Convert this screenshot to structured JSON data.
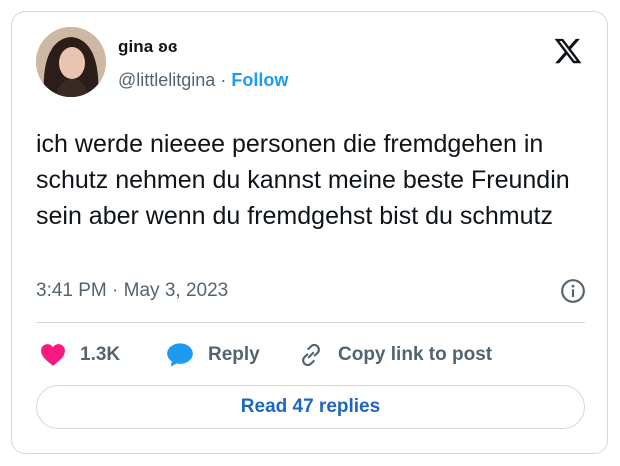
{
  "author": {
    "name": "gina ʚɞ",
    "handle": "@littlelitgina",
    "separator": "·",
    "follow_label": "Follow"
  },
  "tweet": {
    "text": "ich werde nieeee personen die fremdgehen in schutz nehmen du kannst meine beste Freundin sein aber wenn du fremdgehst bist du schmutz",
    "timestamp": "3:41 PM · May 3, 2023"
  },
  "actions": {
    "like_count": "1.3K",
    "reply_label": "Reply",
    "copy_link_label": "Copy link to post"
  },
  "read_replies_label": "Read 47 replies",
  "icons": {
    "brand": "x-logo-icon",
    "info": "info-icon",
    "like": "heart-icon",
    "reply": "speech-bubble-icon",
    "copy": "link-icon"
  },
  "colors": {
    "accent": "#1d9bf0",
    "like": "#f91880",
    "muted_text": "#536471",
    "border": "#cfd9de"
  }
}
